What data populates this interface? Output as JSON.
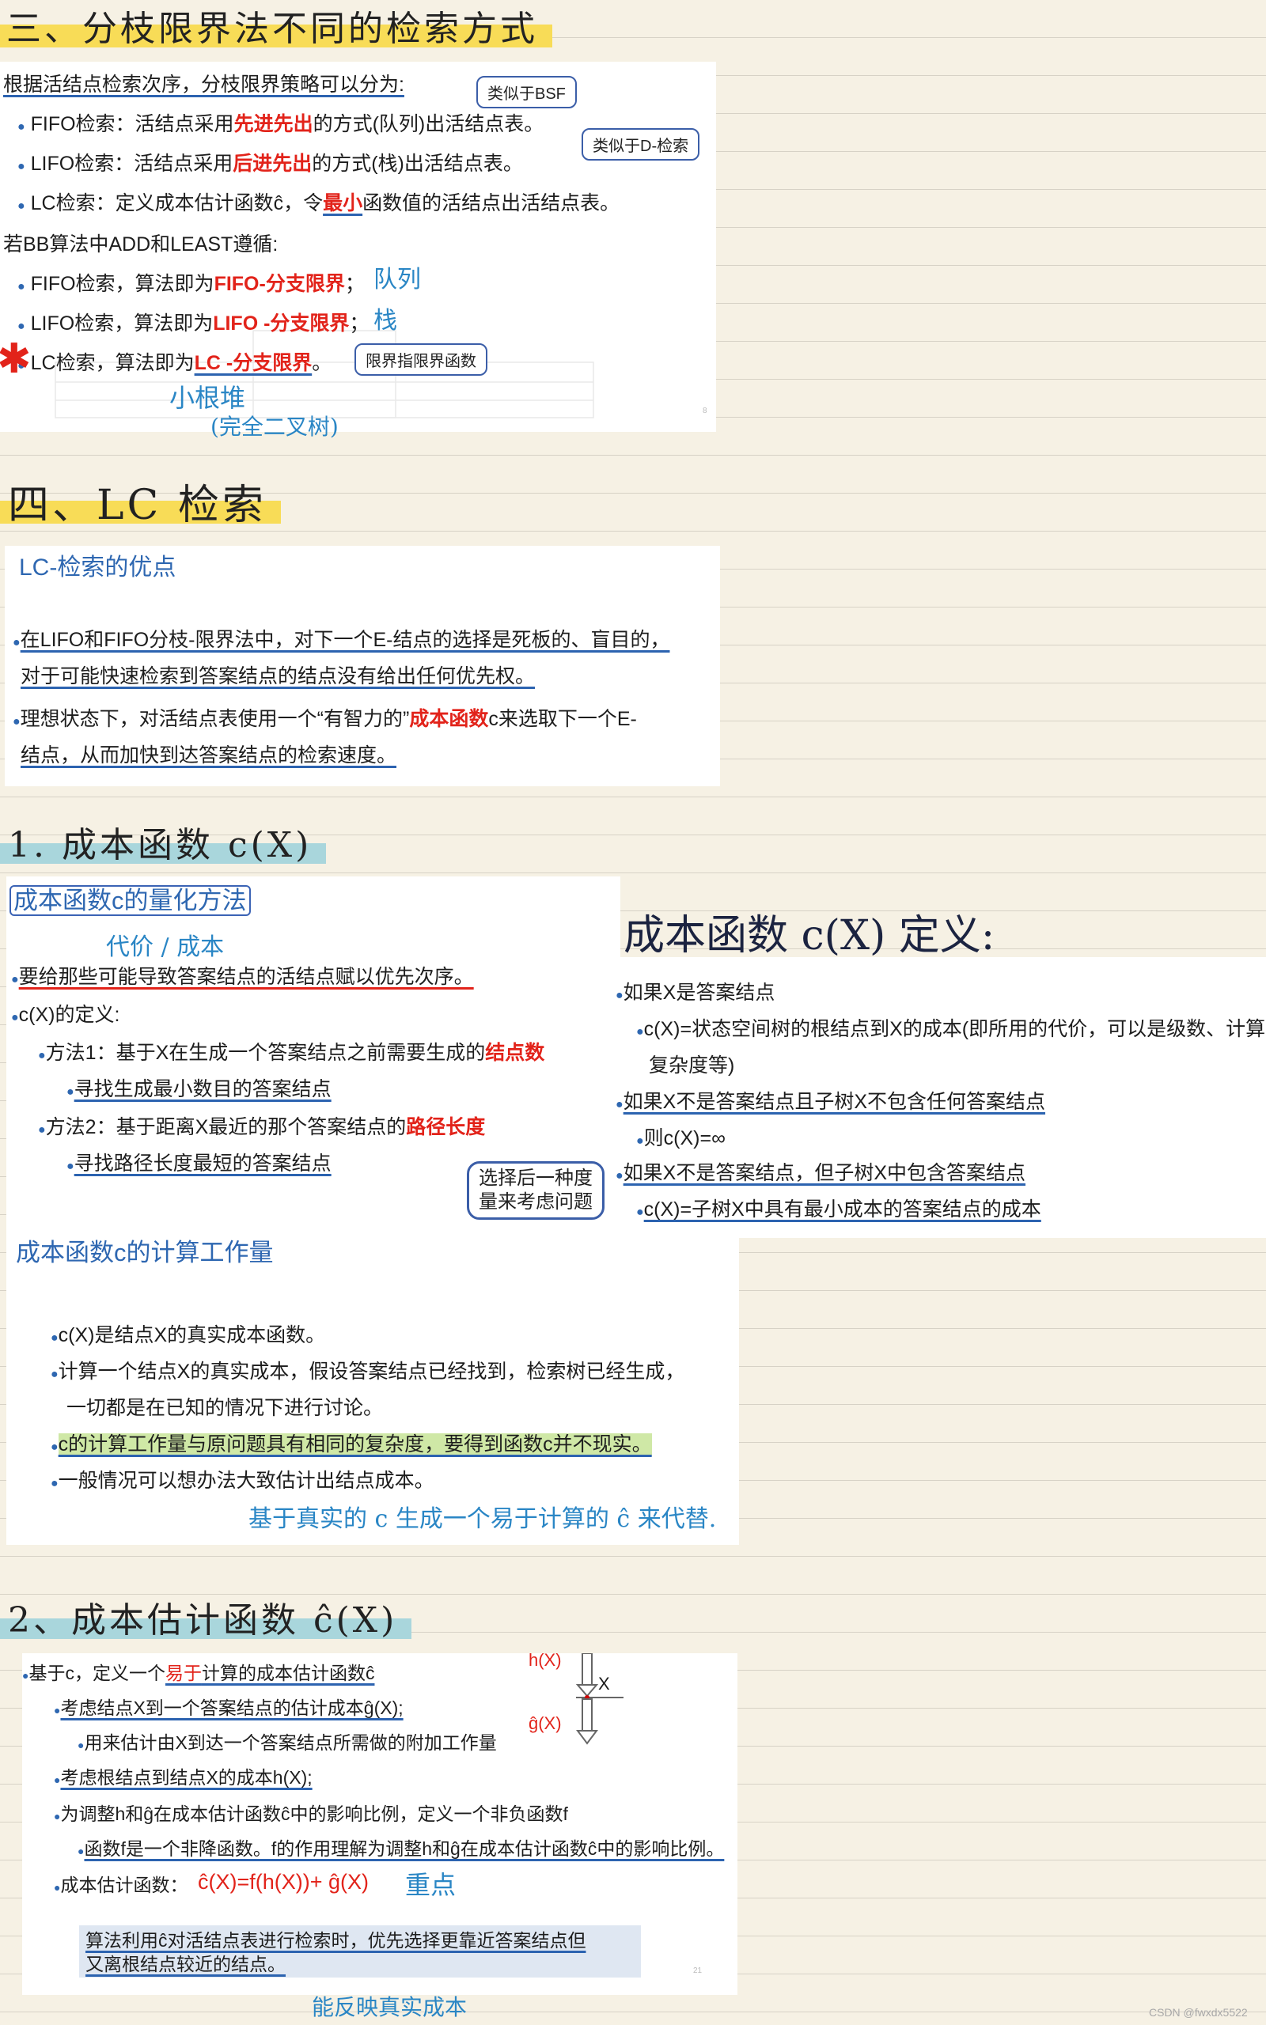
{
  "sec3": {
    "title": "三、分枝限界法不同的检索方式",
    "l1": "根据活结点检索次序，分枝限界策略可以分为:",
    "fifo": {
      "a": "FIFO检索：活结点采用",
      "red": "先进先出",
      "b": "的方式(队列)出活结点表。"
    },
    "lifo": {
      "a": "LIFO检索：活结点采用",
      "red": "后进先出",
      "b": "的方式(栈)出活结点表。"
    },
    "lc": {
      "a": "LC检索：定义成本估计函数ĉ，令",
      "red": "最小",
      "b": "函数值的活结点出活结点表。"
    },
    "l5": "若BB算法中ADD和LEAST遵循:",
    "bb_fifo": {
      "a": "FIFO检索，算法即为",
      "red": "FIFO-分支限界",
      "b": "；"
    },
    "bb_lifo": {
      "a": "LIFO检索，算法即为",
      "red": "LIFO -分支限界",
      "b": "；"
    },
    "bb_lc": {
      "a": "LC检索，算法即为",
      "red": "LC -分支限界",
      "b": "。"
    },
    "bubble_bsf": "类似于BSF",
    "bubble_d": "类似于D-检索",
    "bubble_limit": "限界指限界函数",
    "note_queue": "队列",
    "note_stack": "栈",
    "note_heap": "小根堆",
    "note_tree": "(完全二叉树)",
    "star": "✱",
    "slide_num": "8"
  },
  "sec4": {
    "title": "四、LC 检索",
    "heading": "LC-检索的优点",
    "p1a": "在LIFO和FIFO分枝-限界法中，对下一个E-结点的选择是死板的、盲目的，",
    "p1b": "对于可能快速检索到答案结点的结点没有给出任何优先权。",
    "p2a1": "理想状态下，对活结点表使用一个“有智力的”",
    "p2a_red": "成本函数",
    "p2a2": "c来选取下一个E-",
    "p2b": "结点，从而加快到达答案结点的检索速度。"
  },
  "sub1": {
    "title": "1. 成本函数 c(X)",
    "heading": "成本函数c的量化方法",
    "note_cost": "代价 / 成本",
    "b1": "要给那些可能导致答案结点的活结点赋以优先次序。",
    "b2": "c(X)的定义:",
    "m1a": "方法1：基于X在生成一个答案结点之前需要生成的",
    "m1red": "结点数",
    "m1s": "寻找生成最小数目的答案结点",
    "m2a": "方法2：基于距离X最近的那个答案结点的",
    "m2red": "路径长度",
    "m2s": "寻找路径长度最短的答案结点",
    "bubble_choose_1": "选择后一种度",
    "bubble_choose_2": "量来考虑问题",
    "hand_def": "成本函数 c(X) 定义:",
    "d1": "如果X是答案结点",
    "d1s": "c(X)=状态空间树的根结点到X的成本(即所用的代价，可以是级数、计算",
    "d1s2": "复杂度等)",
    "d2": "如果X不是答案结点且子树X不包含任何答案结点",
    "d2s": "则c(X)=∞",
    "d3": "如果X不是答案结点，但子树X中包含答案结点",
    "d3s": "c(X)=子树X中具有最小成本的答案结点的成本",
    "heading2": "成本函数c的计算工作量",
    "w1": "c(X)是结点X的真实成本函数。",
    "w2a": "计算一个结点X的真实成本，假设答案结点已经找到，检索树已经生成，",
    "w2b": "一切都是在已知的情况下进行讨论。",
    "w3": "c的计算工作量与原问题具有相同的复杂度，要得到函数c并不现实。",
    "w4": "一般情况可以想办法大致估计出结点成本。",
    "note_est": "基于真实的 c 生成一个易于计算的 ĉ 来代替."
  },
  "sub2": {
    "title": "2、成本估计函数 ĉ(X)",
    "e1a": "基于c，定义一个",
    "e1red": "易于",
    "e1b": "计算的成本估计函数ĉ",
    "e2": "考虑结点X到一个答案结点的估计成本ĝ(X);",
    "e2s": "用来估计由X到达一个答案结点所需做的附加工作量",
    "e3": "考虑根结点到结点X的成本h(X);",
    "e4": "为调整h和ĝ在成本估计函数ĉ中的影响比例，定义一个非负函数f",
    "e4s": "函数f是一个非降函数。f的作用理解为调整h和ĝ在成本估计函数ĉ中的影响比例。",
    "e5": "成本估计函数：",
    "formula": "ĉ(X)=f(h(X))+ ĝ(X)",
    "box1": "算法利用ĉ对活结点表进行检索时，优先选择更靠近答案结点但",
    "box2": "又离根结点较近的结点。",
    "diag_h": "h(X)",
    "diag_x": "X",
    "diag_g": "ĝ(X)",
    "note_bottom": "能反映真实成本",
    "note_star": "重点",
    "slide_num": "21"
  },
  "watermark": "CSDN @fwxdx5522"
}
